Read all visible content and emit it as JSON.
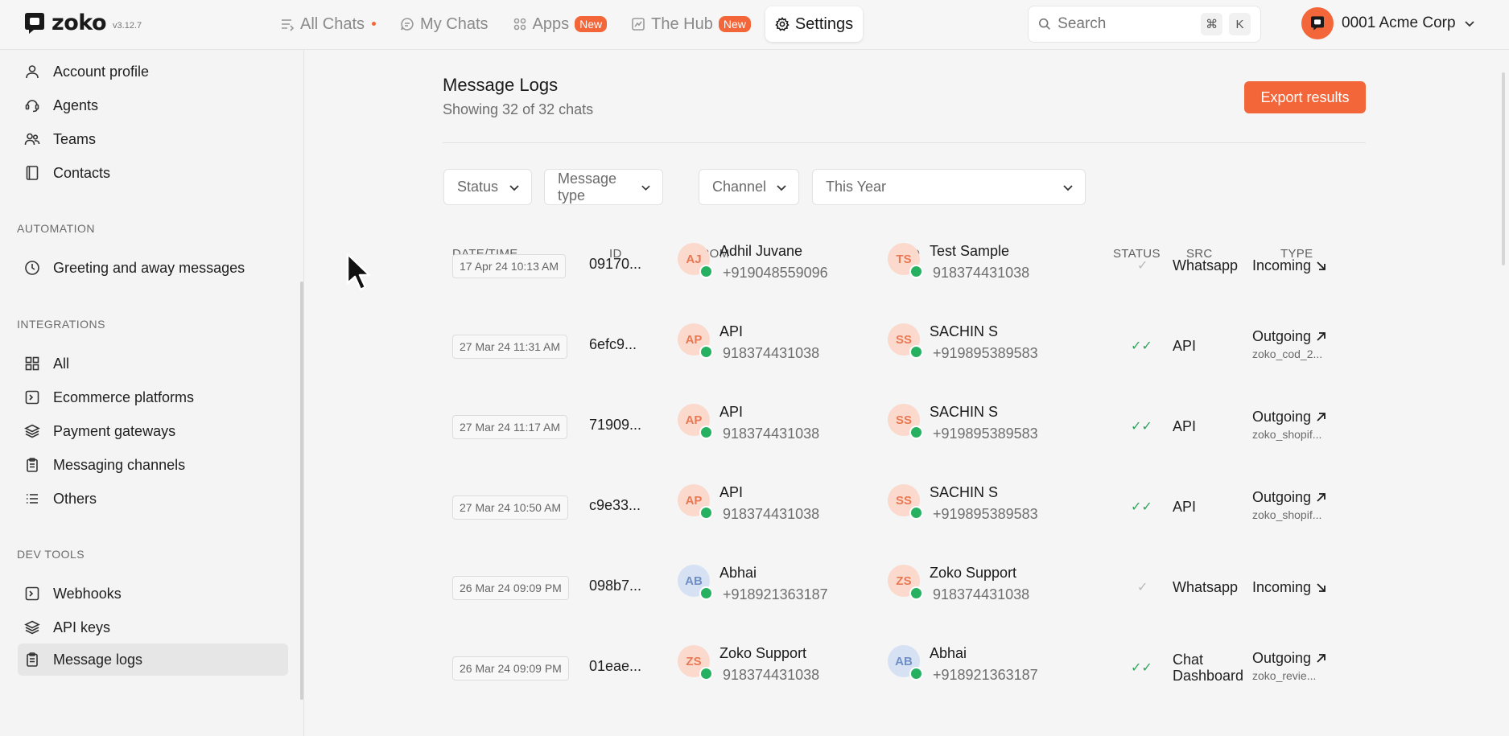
{
  "app": {
    "logo_text": "zoko",
    "version": "v3.12.7"
  },
  "nav": {
    "all_chats": "All Chats",
    "my_chats": "My Chats",
    "apps": "Apps",
    "apps_badge": "New",
    "hub": "The Hub",
    "hub_badge": "New",
    "settings": "Settings"
  },
  "search": {
    "placeholder": "Search",
    "shortcut_cmd": "⌘",
    "shortcut_key": "K"
  },
  "account": {
    "name": "0001 Acme Corp"
  },
  "sidebar": {
    "items_top": [
      {
        "label": "Account profile"
      },
      {
        "label": "Agents"
      },
      {
        "label": "Teams"
      },
      {
        "label": "Contacts"
      }
    ],
    "automation_title": "AUTOMATION",
    "automation_items": [
      {
        "label": "Greeting and away messages"
      }
    ],
    "integrations_title": "INTEGRATIONS",
    "integrations_items": [
      {
        "label": "All"
      },
      {
        "label": "Ecommerce platforms"
      },
      {
        "label": "Payment gateways"
      },
      {
        "label": "Messaging channels"
      },
      {
        "label": "Others"
      }
    ],
    "devtools_title": "DEV TOOLS",
    "devtools_items": [
      {
        "label": "Webhooks"
      },
      {
        "label": "API keys"
      },
      {
        "label": "Message logs"
      }
    ]
  },
  "page": {
    "title": "Message Logs",
    "subtitle": "Showing 32 of 32 chats",
    "export_label": "Export results"
  },
  "filters": {
    "status": "Status",
    "message_type": "Message type",
    "channel": "Channel",
    "date_range": "This Year"
  },
  "table": {
    "headers": {
      "datetime": "DATE/TIME",
      "id": "ID",
      "from": "FROM",
      "to": "TO",
      "status": "STATUS",
      "src": "SRC",
      "type": "TYPE"
    },
    "rows": [
      {
        "datetime": "17 Apr 24 10:13 AM",
        "id": "09170...",
        "from_initials": "AJ",
        "from_name": "Adhil Juvane",
        "from_number": "+919048559096",
        "to_initials": "TS",
        "to_name": "Test Sample",
        "to_number": "918374431038",
        "status": "✓",
        "src": "Whatsapp",
        "src2": "",
        "type": "Incoming",
        "type_sub": ""
      },
      {
        "datetime": "27 Mar 24 11:31 AM",
        "id": "6efc9...",
        "from_initials": "AP",
        "from_name": "API",
        "from_number": "918374431038",
        "to_initials": "SS",
        "to_name": "SACHIN S",
        "to_number": "+919895389583",
        "status": "✓✓",
        "src": "API",
        "src2": "",
        "type": "Outgoing",
        "type_sub": "zoko_cod_2..."
      },
      {
        "datetime": "27 Mar 24 11:17 AM",
        "id": "71909...",
        "from_initials": "AP",
        "from_name": "API",
        "from_number": "918374431038",
        "to_initials": "SS",
        "to_name": "SACHIN S",
        "to_number": "+919895389583",
        "status": "✓✓",
        "src": "API",
        "src2": "",
        "type": "Outgoing",
        "type_sub": "zoko_shopif..."
      },
      {
        "datetime": "27 Mar 24 10:50 AM",
        "id": "c9e33...",
        "from_initials": "AP",
        "from_name": "API",
        "from_number": "918374431038",
        "to_initials": "SS",
        "to_name": "SACHIN S",
        "to_number": "+919895389583",
        "status": "✓✓",
        "src": "API",
        "src2": "",
        "type": "Outgoing",
        "type_sub": "zoko_shopif..."
      },
      {
        "datetime": "26 Mar 24 09:09 PM",
        "id": "098b7...",
        "from_initials": "AB",
        "from_name": "Abhai",
        "from_number": "+918921363187",
        "to_initials": "ZS",
        "to_name": "Zoko Support",
        "to_number": "918374431038",
        "status": "✓",
        "src": "Whatsapp",
        "src2": "",
        "type": "Incoming",
        "type_sub": ""
      },
      {
        "datetime": "26 Mar 24 09:09 PM",
        "id": "01eae...",
        "from_initials": "ZS",
        "from_name": "Zoko Support",
        "from_number": "918374431038",
        "to_initials": "AB",
        "to_name": "Abhai",
        "to_number": "+918921363187",
        "status": "✓✓",
        "src": "Chat",
        "src2": "Dashboard",
        "type": "Outgoing",
        "type_sub": "zoko_revie..."
      }
    ]
  },
  "colors": {
    "accent": "#f3663a",
    "whatsapp_green": "#25b15f",
    "status_read": "#31a35a"
  }
}
